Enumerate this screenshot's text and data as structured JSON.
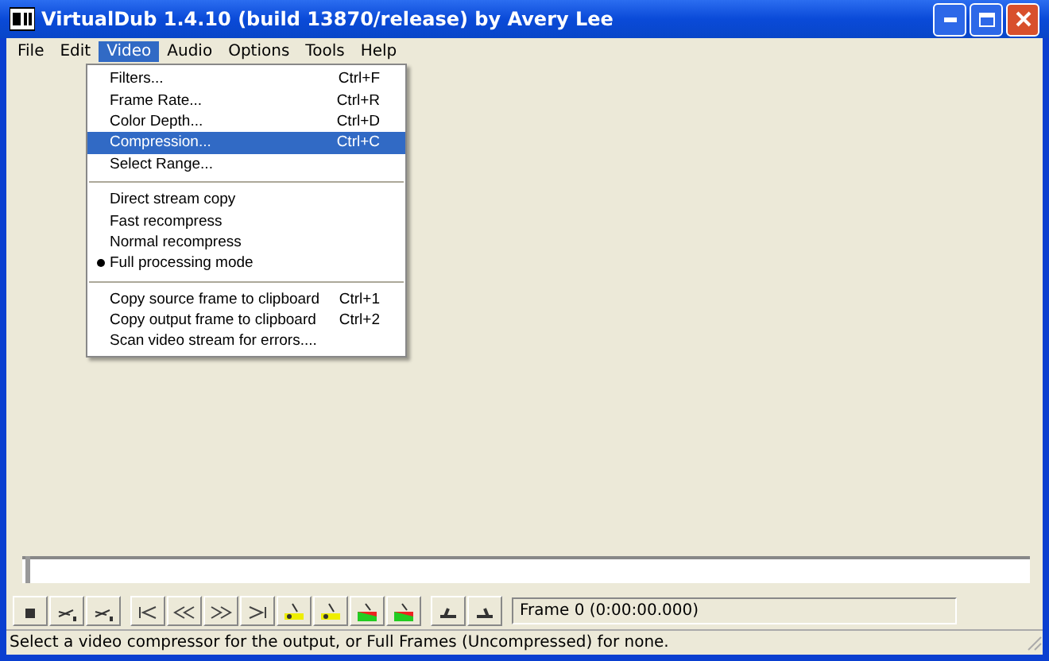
{
  "window": {
    "title": "VirtualDub 1.4.10 (build 13870/release) by Avery Lee"
  },
  "menu_bar": [
    {
      "label": "File",
      "selected": false
    },
    {
      "label": "Edit",
      "selected": false
    },
    {
      "label": "Video",
      "selected": true
    },
    {
      "label": "Audio",
      "selected": false
    },
    {
      "label": "Options",
      "selected": false
    },
    {
      "label": "Tools",
      "selected": false
    },
    {
      "label": "Help",
      "selected": false
    }
  ],
  "dropdown": [
    {
      "kind": "item",
      "label": "Filters...",
      "shortcut": "Ctrl+F",
      "selected": false,
      "checked": false
    },
    {
      "kind": "item",
      "label": "Frame Rate...",
      "shortcut": "Ctrl+R",
      "selected": false,
      "checked": false
    },
    {
      "kind": "item",
      "label": "Color Depth...",
      "shortcut": "Ctrl+D",
      "selected": false,
      "checked": false
    },
    {
      "kind": "item",
      "label": "Compression...",
      "shortcut": "Ctrl+C",
      "selected": true,
      "checked": false
    },
    {
      "kind": "item",
      "label": "Select Range...",
      "selected": false,
      "checked": false
    },
    {
      "kind": "separator"
    },
    {
      "kind": "item",
      "label": "Direct stream copy",
      "selected": false,
      "checked": false
    },
    {
      "kind": "item",
      "label": "Fast recompress",
      "selected": false,
      "checked": false
    },
    {
      "kind": "item",
      "label": "Normal recompress",
      "selected": false,
      "checked": false
    },
    {
      "kind": "item",
      "label": "Full processing mode",
      "selected": false,
      "checked": true
    },
    {
      "kind": "separator"
    },
    {
      "kind": "item",
      "label": "Copy source frame to clipboard",
      "shortcut": "Ctrl+1",
      "selected": false,
      "checked": false
    },
    {
      "kind": "item",
      "label": "Copy output frame to clipboard",
      "shortcut": "Ctrl+2",
      "selected": false,
      "checked": false
    },
    {
      "kind": "item",
      "label": "Scan video stream for errors....",
      "selected": false,
      "checked": false
    }
  ],
  "position_slider": {
    "level": 0
  },
  "frame_field": {
    "value": "Frame 0 (0:00:00.000)"
  },
  "status_bar": "Select a video compressor for the output, or Full Frames (Uncompressed) for none."
}
